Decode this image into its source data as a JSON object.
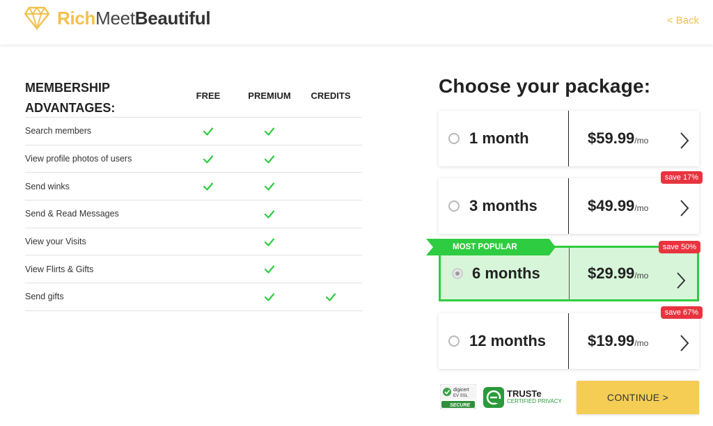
{
  "header": {
    "logo": {
      "rich": "Rich",
      "meet": "Meet",
      "beautiful": "Beautiful",
      "icon": "diamond-icon",
      "brand_color": "#f2c14f"
    },
    "back_label": "< Back"
  },
  "advantages": {
    "title_line1": "MEMBERSHIP",
    "title_line2": "ADVANTAGES:",
    "columns": [
      "FREE",
      "PREMIUM",
      "CREDITS"
    ],
    "rows": [
      {
        "label": "Search members",
        "free": true,
        "premium": true,
        "credits": false
      },
      {
        "label": "View profile photos of users",
        "free": true,
        "premium": true,
        "credits": false
      },
      {
        "label": "Send winks",
        "free": true,
        "premium": true,
        "credits": false
      },
      {
        "label": "Send & Read Messages",
        "free": false,
        "premium": true,
        "credits": false
      },
      {
        "label": "View your Visits",
        "free": false,
        "premium": true,
        "credits": false
      },
      {
        "label": "View Flirts & Gifts",
        "free": false,
        "premium": true,
        "credits": false
      },
      {
        "label": "Send gifts",
        "free": false,
        "premium": true,
        "credits": true
      }
    ],
    "check_color": "#2ecc40"
  },
  "packages": {
    "title": "Choose your package:",
    "popular_label": "MOST POPULAR",
    "per_unit": "/mo",
    "items": [
      {
        "name": "1 month",
        "price": "$59.99",
        "save": "",
        "selected": false
      },
      {
        "name": "3 months",
        "price": "$49.99",
        "save": "save 17%",
        "selected": false
      },
      {
        "name": "6 months",
        "price": "$29.99",
        "save": "save 50%",
        "selected": true
      },
      {
        "name": "12 months",
        "price": "$19.99",
        "save": "save 67%",
        "selected": false
      }
    ],
    "popular_color": "#2ecc40",
    "save_color": "#e8343f"
  },
  "trust": {
    "digicert": {
      "line1": "digicert",
      "line2": "EV SSL",
      "line3": "SECURE"
    },
    "truste": {
      "name": "TRUSTe",
      "sub": "CERTIFIED PRIVACY"
    }
  },
  "continue_label": "CONTINUE >"
}
